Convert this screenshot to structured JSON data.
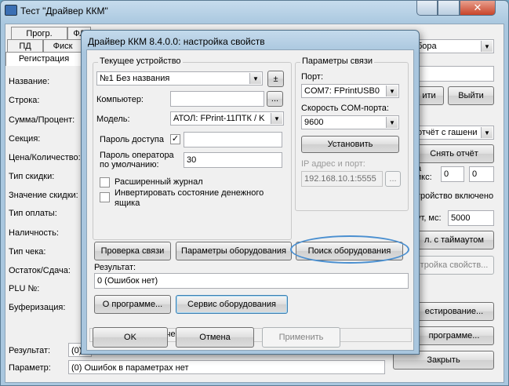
{
  "main_window": {
    "title": "Тест \"Драйвер ККМ\"",
    "caption_close": "✕",
    "tabs_row1": [
      "Прогр.",
      "ФЛ (ОФД)"
    ],
    "tabs_row2": [
      "ПД",
      "Фиск"
    ],
    "active_subtab": "Регистрация",
    "labels": [
      "Название:",
      "Строка:",
      "Сумма/Процент:",
      "Секция:",
      "Цена/Количество:",
      "Тип скидки:",
      "Значение скидки:",
      "Тип оплаты:",
      "Наличность:",
      "Тип чека:",
      "Остаток/Сдача:",
      "PLU №:",
      "Буферизация:"
    ],
    "right": {
      "combo1_value": "бора",
      "btn_pri": "ити",
      "btn_exit": "Выйти",
      "combo2_value": "отчёт с гашение",
      "btn_cancel_report": "Снять отчёт",
      "label_a": "а",
      "label_ikc": "икс:",
      "input_a": "0",
      "input_b": "0",
      "status_device": "тройство включено",
      "label_timeout": "ут, мс:",
      "input_timeout": "5000",
      "btn_timeout": "л. с таймаутом",
      "btn_props": "тройка свойств...",
      "btn_test": "естирование...",
      "btn_about": "программе...",
      "btn_close": "Закрыть"
    },
    "result_label": "Результат:",
    "result_value": "(0) Ошибок нет",
    "param_label": "Параметр:",
    "param_value": "(0) Ошибок в параметрах нет"
  },
  "dialog": {
    "title": "Драйвер ККМ 8.4.0.0: настройка свойств",
    "current_device": {
      "group_title": "Текущее устройство",
      "device_value": "№1 Без названия",
      "plusminus": "±",
      "computer_label": "Компьютер:",
      "computer_value": "",
      "browse": "...",
      "model_label": "Модель:",
      "model_value": "АТОЛ: FPrint-11ПТК / K",
      "access_pwd_label": "Пароль доступа",
      "access_pwd_value": "",
      "operator_pwd_label_1": "Пароль оператора",
      "operator_pwd_label_2": "по умолчанию:",
      "operator_pwd_value": "30",
      "ext_journal_label": "Расширенный журнал",
      "invert_label_1": "Инвертировать состояние денежного",
      "invert_label_2": "ящика"
    },
    "connection": {
      "group_title": "Параметры связи",
      "port_label": "Порт:",
      "port_value": "COM7: FPrintUSB0",
      "speed_label": "Скорость COM-порта:",
      "speed_value": "9600",
      "setup_button": "Установить",
      "ip_label": "IP адрес и порт:",
      "ip_value": "192.168.10.1:5555",
      "ip_browse": "..."
    },
    "buttons": {
      "check_connection": "Проверка связи",
      "equipment_params": "Параметры оборудования",
      "search_equipment": "Поиск оборудования",
      "about": "О программе...",
      "equipment_service": "Сервис оборудования",
      "ok": "OK",
      "cancel": "Отмена",
      "apply": "Применить"
    },
    "result_label": "Результат:",
    "result_value": "0 (Ошибок нет)",
    "status_text": "Устройство выключено"
  }
}
